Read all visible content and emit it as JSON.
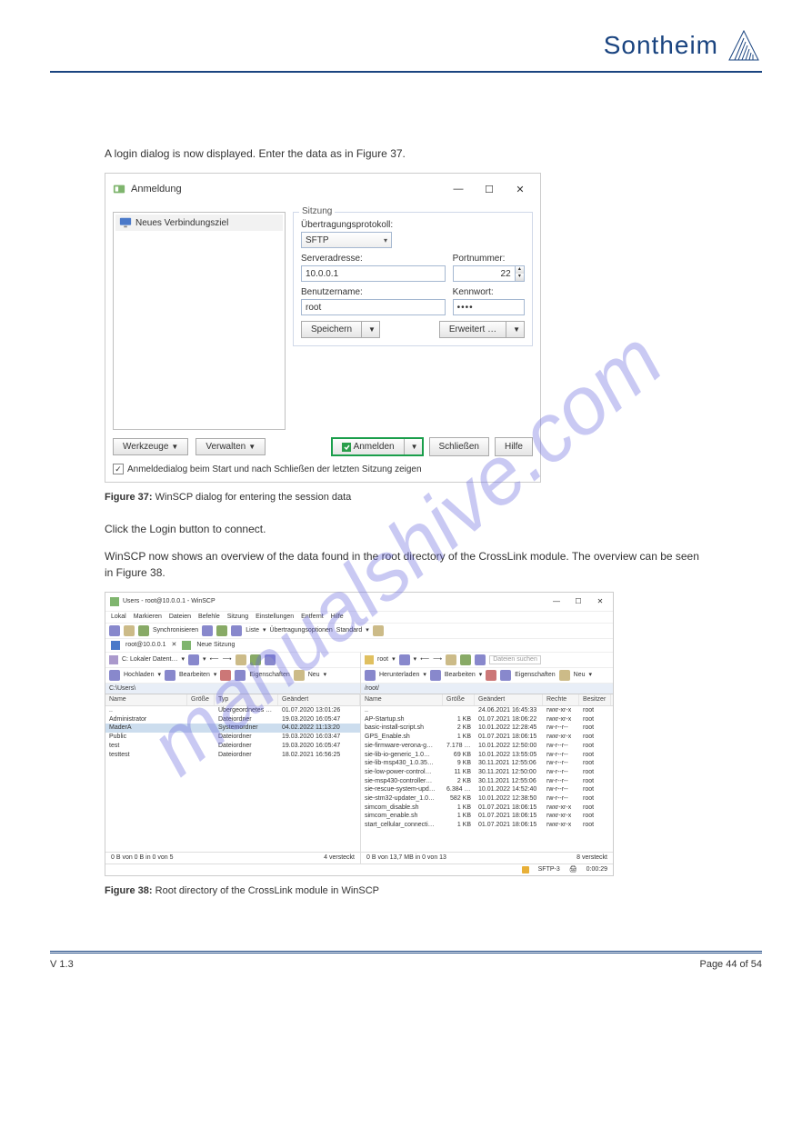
{
  "brand": "Sontheim",
  "paragraphs": {
    "p1": "A login dialog is now displayed. Enter the data as in Figure 37.",
    "p2": "Click the Login button to connect.",
    "p3": "WinSCP now shows an overview of the data found in the root directory of the CrossLink module. The overview can be seen in Figure 38."
  },
  "captions": {
    "c1_label": "Figure 37:",
    "c1_text": " WinSCP dialog for entering the session data",
    "c2_label": "Figure 38:",
    "c2_text": " Root directory of the CrossLink module in WinSCP"
  },
  "login": {
    "title": "Anmeldung",
    "tree_item": "Neues Verbindungsziel",
    "group_title": "Sitzung",
    "protocol_label": "Übertragungsprotokoll:",
    "protocol_value": "SFTP",
    "server_label": "Serveradresse:",
    "server_value": "10.0.0.1",
    "port_label": "Portnummer:",
    "port_value": "22",
    "user_label": "Benutzername:",
    "user_value": "root",
    "pass_label": "Kennwort:",
    "pass_value": "••••",
    "save": "Speichern",
    "advanced": "Erweitert …",
    "tools": "Werkzeuge",
    "manage": "Verwalten",
    "login_btn": "Anmelden",
    "close_btn": "Schließen",
    "help_btn": "Hilfe",
    "checkbox_label": "Anmeldedialog beim Start und nach Schließen der letzten Sitzung zeigen"
  },
  "fb": {
    "title": "Users - root@10.0.0.1 - WinSCP",
    "menus": [
      "Lokal",
      "Markieren",
      "Dateien",
      "Befehle",
      "Sitzung",
      "Einstellungen",
      "Entfernt",
      "Hilfe"
    ],
    "toolbar_labels": {
      "sync": "Synchronisieren",
      "queue": "Liste",
      "opts": "Übertragungsoptionen",
      "std": "Standard"
    },
    "session_tab": "root@10.0.0.1",
    "new_session": "Neue Sitzung",
    "local_nav": "C: Lokaler Datent…",
    "remote_nav": "root",
    "search_placeholder": "Dateien suchen",
    "local_actions": {
      "upload": "Hochladen",
      "edit": "Bearbeiten",
      "props": "Eigenschaften",
      "new": "Neu"
    },
    "remote_actions": {
      "download": "Herunterladen",
      "edit": "Bearbeiten",
      "props": "Eigenschaften",
      "new": "Neu"
    },
    "local_path": "C:\\Users\\",
    "remote_path": "/root/",
    "local_cols": [
      "Name",
      "Größe",
      "Typ",
      "Geändert"
    ],
    "remote_cols": [
      "Name",
      "Größe",
      "Geändert",
      "Rechte",
      "Besitzer"
    ],
    "local_rows": [
      {
        "name": "..",
        "size": "",
        "type": "Übergeordnetes Ve…",
        "mod": "01.07.2020 13:01:26"
      },
      {
        "name": "Administrator",
        "size": "",
        "type": "Dateiordner",
        "mod": "19.03.2020 16:05:47"
      },
      {
        "name": "MaderA",
        "size": "",
        "type": "Systemordner",
        "mod": "04.02.2022 11:13:20",
        "sel": true
      },
      {
        "name": "Public",
        "size": "",
        "type": "Dateiordner",
        "mod": "19.03.2020 16:03:47"
      },
      {
        "name": "test",
        "size": "",
        "type": "Dateiordner",
        "mod": "19.03.2020 16:05:47"
      },
      {
        "name": "testtest",
        "size": "",
        "type": "Dateiordner",
        "mod": "18.02.2021 16:56:25"
      }
    ],
    "remote_rows": [
      {
        "name": "..",
        "size": "",
        "mod": "24.06.2021 16:45:33",
        "perm": "rwxr-xr-x",
        "own": "root"
      },
      {
        "name": "AP-Startup.sh",
        "size": "1 KB",
        "mod": "01.07.2021 18:06:22",
        "perm": "rwxr-xr-x",
        "own": "root"
      },
      {
        "name": "basic-install-script.sh",
        "size": "2 KB",
        "mod": "10.01.2022 12:28:45",
        "perm": "rw-r--r--",
        "own": "root"
      },
      {
        "name": "GPS_Enable.sh",
        "size": "1 KB",
        "mod": "01.07.2021 18:06:15",
        "perm": "rwxr-xr-x",
        "own": "root"
      },
      {
        "name": "sie-firmware-verona-g…",
        "size": "7.178 KB",
        "mod": "10.01.2022 12:50:00",
        "perm": "rw-r--r--",
        "own": "root"
      },
      {
        "name": "sie-lib-io-generic_1.0…",
        "size": "69 KB",
        "mod": "10.01.2022 13:55:05",
        "perm": "rw-r--r--",
        "own": "root"
      },
      {
        "name": "sie-lib-msp430_1.0.35…",
        "size": "9 KB",
        "mod": "30.11.2021 12:55:06",
        "perm": "rw-r--r--",
        "own": "root"
      },
      {
        "name": "sie-low-power-control…",
        "size": "11 KB",
        "mod": "30.11.2021 12:50:00",
        "perm": "rw-r--r--",
        "own": "root"
      },
      {
        "name": "sie-msp430-controller…",
        "size": "2 KB",
        "mod": "30.11.2021 12:55:06",
        "perm": "rw-r--r--",
        "own": "root"
      },
      {
        "name": "sie-rescue-system-upd…",
        "size": "6.384 KB",
        "mod": "10.01.2022 14:52:40",
        "perm": "rw-r--r--",
        "own": "root"
      },
      {
        "name": "sie-stm32-updater_1.0…",
        "size": "582 KB",
        "mod": "10.01.2022 12:38:50",
        "perm": "rw-r--r--",
        "own": "root"
      },
      {
        "name": "simcom_disable.sh",
        "size": "1 KB",
        "mod": "01.07.2021 18:06:15",
        "perm": "rwxr-xr-x",
        "own": "root"
      },
      {
        "name": "simcom_enable.sh",
        "size": "1 KB",
        "mod": "01.07.2021 18:06:15",
        "perm": "rwxr-xr-x",
        "own": "root"
      },
      {
        "name": "start_cellular_connecti…",
        "size": "1 KB",
        "mod": "01.07.2021 18:06:15",
        "perm": "rwxr-xr-x",
        "own": "root"
      }
    ],
    "status_left": "0 B von 0 B in 0 von 5",
    "status_left_hidden": "4 versteckt",
    "status_right": "0 B von 13,7 MB in 0 von 13",
    "status_right_hidden": "8 versteckt",
    "bottom_proto": "SFTP-3",
    "bottom_time": "0:00:29"
  },
  "footer": {
    "version": "V 1.3",
    "pages": "Page 44 of 54"
  },
  "watermark": "manualshive.com"
}
